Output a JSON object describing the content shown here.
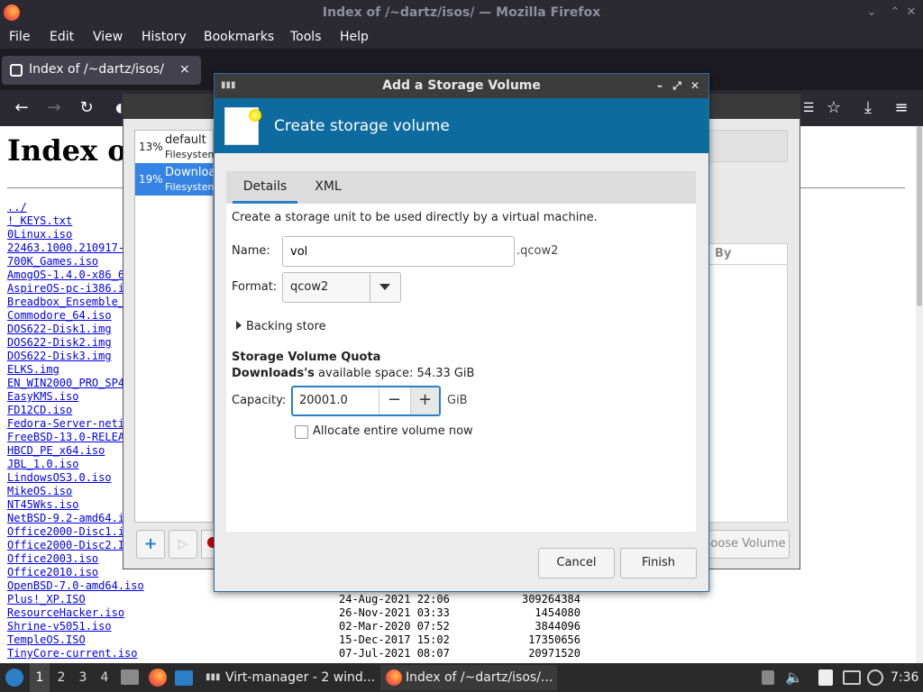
{
  "firefox": {
    "window_title": "Index of /~dartz/isos/ — Mozilla Firefox",
    "menu": [
      "File",
      "Edit",
      "View",
      "History",
      "Bookmarks",
      "Tools",
      "Help"
    ],
    "tab_title": "Index of /~dartz/isos/",
    "tab_close": "×"
  },
  "page": {
    "heading": "Index o",
    "files": [
      "../",
      "!_KEYS.txt",
      "0Linux.iso",
      "22463.1000.210917-",
      "700K_Games.iso",
      "AmogOS-1.4.0-x86_6",
      "AspireOS-pc-i386.i",
      "Breadbox_Ensemble_",
      "Commodore_64.iso",
      "DOS622-Disk1.img",
      "DOS622-Disk2.img",
      "DOS622-Disk3.img",
      "ELKS.img",
      "EN_WIN2000_PRO_SP4",
      "EasyKMS.iso",
      "FD12CD.iso",
      "Fedora-Server-neti",
      "FreeBSD-13.0-RELEA",
      "HBCD_PE_x64.iso",
      "JBL_1.0.iso",
      "LindowsOS3.0.iso",
      "MikeOS.iso",
      "NT45Wks.iso",
      "NetBSD-9.2-amd64.i",
      "Office2000-Disc1.i",
      "Office2000-Disc2.I",
      "Office2003.iso",
      "Office2010.iso",
      "OpenBSD-7.0-amd64.iso",
      "Plus!_XP.ISO",
      "ResourceHacker.iso",
      "Shrine-v5051.iso",
      "TempleOS.ISO",
      "TinyCore-current.iso"
    ],
    "listing_tail": [
      {
        "date": "24-Aug-2021 22:06",
        "size": "309264384"
      },
      {
        "date": "26-Nov-2021 03:33",
        "size": "1454080"
      },
      {
        "date": "02-Mar-2020 07:52",
        "size": "3844096"
      },
      {
        "date": "15-Dec-2017 15:02",
        "size": "17350656"
      },
      {
        "date": "07-Jul-2021 08:07",
        "size": "20971520"
      }
    ]
  },
  "virt_manager": {
    "pools": [
      {
        "pct": "13%",
        "name": "default",
        "type": "Filesystem"
      },
      {
        "pct": "19%",
        "name": "Downloads",
        "type": "Filesystem"
      }
    ],
    "column_by": "By",
    "choose_volume": "Choose Volume",
    "add_btn": "+",
    "play_btn": "▷"
  },
  "dialog": {
    "title": "Add a Storage Volume",
    "header": "Create storage volume",
    "tabs": [
      "Details",
      "XML"
    ],
    "description": "Create a storage unit to be used directly by a virtual machine.",
    "name_label": "Name:",
    "name_value": "vol",
    "name_suffix": ".qcow2",
    "format_label": "Format:",
    "format_value": "qcow2",
    "backing_store": "Backing store",
    "quota_heading": "Storage Volume Quota",
    "pool_name": "Downloads's",
    "available_text": " available space: 54.33 GiB",
    "capacity_label": "Capacity:",
    "capacity_value": "20001.0",
    "minus": "−",
    "plus": "+",
    "capacity_unit": "GiB",
    "allocate_label": "Allocate entire volume now",
    "allocate_checked": false,
    "cancel": "Cancel",
    "finish": "Finish"
  },
  "taskbar": {
    "workspaces": [
      "1",
      "2",
      "3",
      "4"
    ],
    "tasks": [
      "Virt-manager - 2 wind...",
      "Index of /~dartz/isos/..."
    ],
    "clock": "7:36"
  },
  "colors": {
    "accent": "#2a7fc7",
    "dialog_header": "#0d6ba0",
    "selected_row": "#3584e4",
    "link": "#0000ee"
  }
}
